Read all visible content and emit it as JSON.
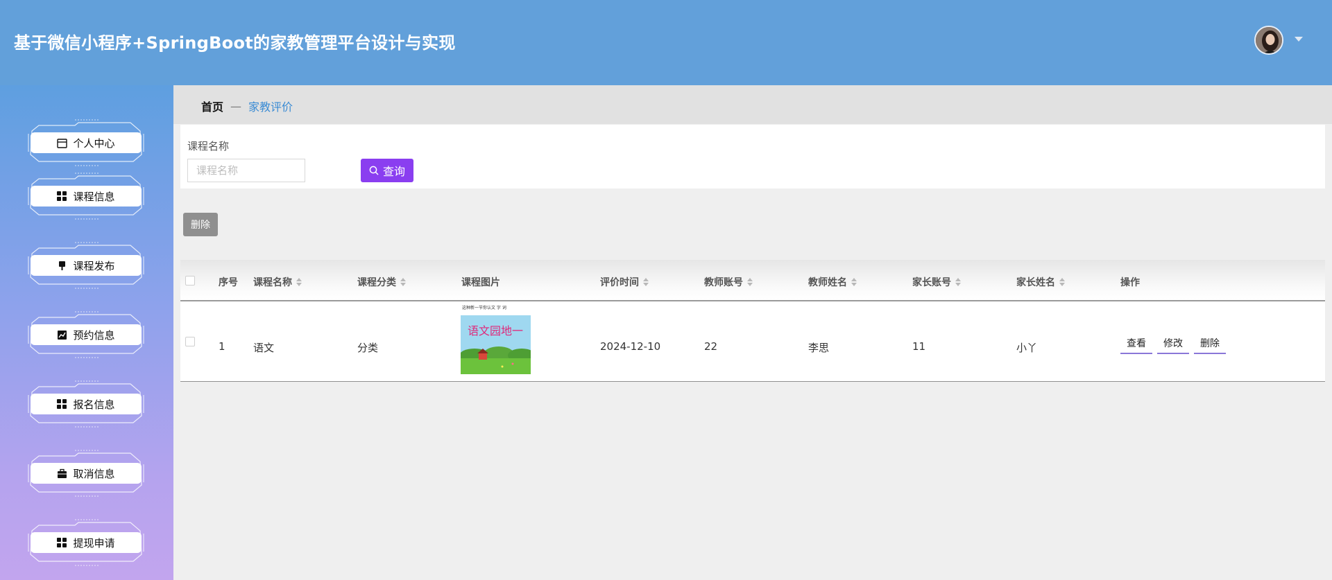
{
  "header": {
    "title": "基于微信小程序+SpringBoot的家教管理平台设计与实现"
  },
  "sidebar": {
    "items": [
      {
        "label": "个人中心",
        "icon": "calendar-icon"
      },
      {
        "label": "课程信息",
        "icon": "grid-icon"
      },
      {
        "label": "课程发布",
        "icon": "pin-icon"
      },
      {
        "label": "预约信息",
        "icon": "chart-icon"
      },
      {
        "label": "报名信息",
        "icon": "grid-icon"
      },
      {
        "label": "取消信息",
        "icon": "briefcase-icon"
      },
      {
        "label": "提现申请",
        "icon": "grid-icon"
      }
    ]
  },
  "breadcrumb": {
    "home": "首页",
    "separator": "—",
    "current": "家教评价"
  },
  "search": {
    "label": "课程名称",
    "placeholder": "课程名称",
    "value": "",
    "button_label": "查询"
  },
  "toolbar": {
    "delete_label": "删除"
  },
  "table": {
    "columns": [
      "序号",
      "课程名称",
      "课程分类",
      "课程图片",
      "评价时间",
      "教师账号",
      "教师姓名",
      "家长账号",
      "家长姓名",
      "操作"
    ],
    "rows": [
      {
        "index": "1",
        "course_name": "语文",
        "category": "分类",
        "image_text": "语文园地一",
        "image_caption": "这种新一节你认文 字 词",
        "review_time": "2024-12-10",
        "teacher_account": "22",
        "teacher_name": "李思",
        "parent_account": "11",
        "parent_name": "小丫",
        "actions": {
          "view": "查看",
          "edit": "修改",
          "delete": "删除"
        }
      }
    ]
  },
  "colors": {
    "header_bg": "#62a0da",
    "accent_purple": "#8a3ef0",
    "breadcrumb_current": "#3a8bd4"
  }
}
